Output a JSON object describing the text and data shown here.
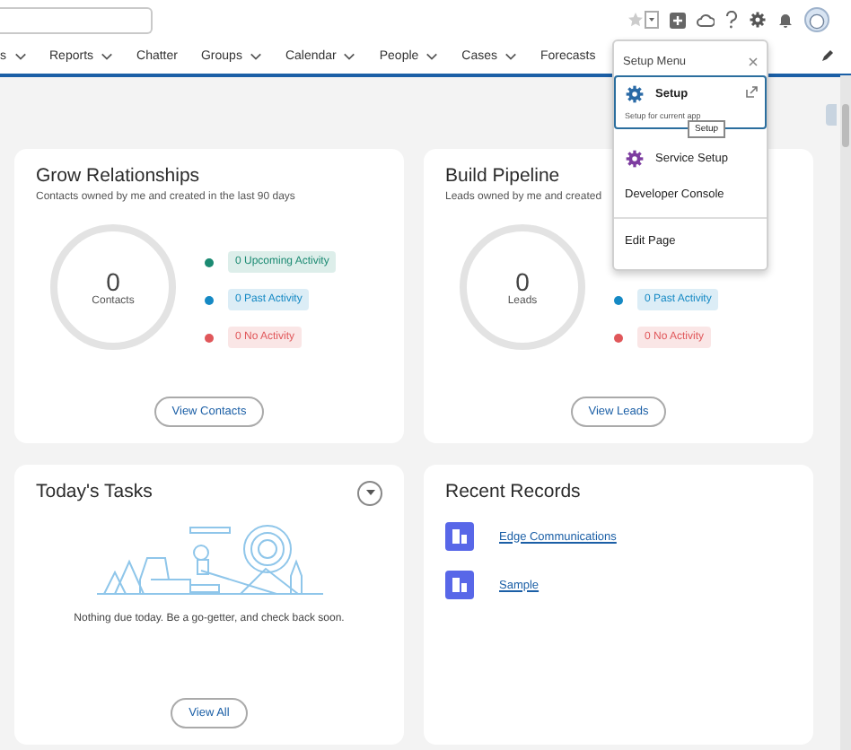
{
  "nav": {
    "items": [
      {
        "label": "s",
        "dropdown": true
      },
      {
        "label": "Reports",
        "dropdown": true
      },
      {
        "label": "Chatter",
        "dropdown": false
      },
      {
        "label": "Groups",
        "dropdown": true
      },
      {
        "label": "Calendar",
        "dropdown": true
      },
      {
        "label": "People",
        "dropdown": true
      },
      {
        "label": "Cases",
        "dropdown": true
      },
      {
        "label": "Forecasts",
        "dropdown": false
      }
    ]
  },
  "cards": [
    {
      "kind": "summary",
      "title": "Grow Relationships",
      "subtitle": "Contacts owned by me and created in the last 90 days",
      "count": "0",
      "count_label": "Contacts",
      "legend": [
        {
          "label": "0 Upcoming Activity",
          "color": "#1b8a72"
        },
        {
          "label": "0 Past Activity",
          "color": "#1589c4"
        },
        {
          "label": "0 No Activity",
          "color": "#e0575a"
        }
      ],
      "button": "View Contacts"
    },
    {
      "kind": "summary",
      "title": "Build Pipeline",
      "subtitle": "Leads owned by me and created",
      "count": "0",
      "count_label": "Leads",
      "legend": [
        {
          "label": "0 Past Activity",
          "color": "#1589c4"
        },
        {
          "label": "0 No Activity",
          "color": "#e0575a"
        }
      ],
      "button": "View Leads"
    },
    {
      "kind": "tasks",
      "title": "Today's Tasks",
      "message": "Nothing due today. Be a go-getter, and check back soon.",
      "button": "View All"
    },
    {
      "kind": "records",
      "title": "Recent Records",
      "records": [
        {
          "label": "Edge Communications"
        },
        {
          "label": "Sample"
        }
      ]
    }
  ],
  "setup_menu": {
    "title": "Setup Menu",
    "items": [
      {
        "kind": "app",
        "label": "Setup",
        "subtitle": "Setup for current app",
        "selected": true,
        "tooltip": "Setup"
      },
      {
        "kind": "app",
        "label": "Service Setup",
        "selected": false
      },
      {
        "kind": "link",
        "label": "Developer Console",
        "selected": false
      },
      {
        "kind": "divider"
      },
      {
        "kind": "link",
        "label": "Edit Page",
        "selected": false
      }
    ]
  }
}
